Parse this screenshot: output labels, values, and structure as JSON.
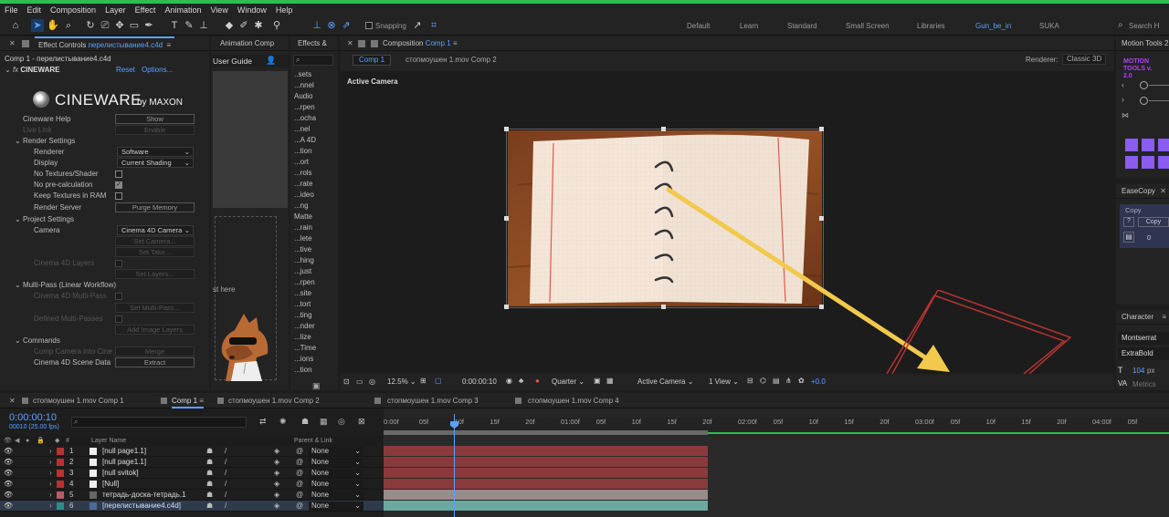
{
  "menu": [
    "File",
    "Edit",
    "Composition",
    "Layer",
    "Effect",
    "Animation",
    "View",
    "Window",
    "Help"
  ],
  "toolbar": {
    "snapping_label": "Snapping",
    "workspaces": [
      "Default",
      "Learn",
      "Standard",
      "Small Screen",
      "Libraries",
      "Gun_be_in",
      "SUKA"
    ],
    "search_placeholder": "Search H"
  },
  "effect_controls": {
    "tab_label": "Effect Controls",
    "tab_file": "перелистывание4.c4d",
    "layer_path": "Comp 1 - перелистывание4.c4d",
    "fx_name": "CINEWARE",
    "reset": "Reset",
    "options": "Options...",
    "logo_text": "CINEWARE",
    "logo_by": "by MAXON",
    "rows": {
      "help_label": "Cineware Help",
      "help_btn": "Show",
      "live_link": "Live Link",
      "live_btn": "Enable",
      "render_settings": "Render Settings",
      "renderer_label": "Renderer",
      "renderer_value": "Software",
      "display_label": "Display",
      "display_value": "Current Shading",
      "no_textures": "No Textures/Shader",
      "no_precalc": "No pre-calculation",
      "keep_textures": "Keep Textures in RAM",
      "render_server": "Render Server",
      "purge_btn": "Purge Memory",
      "project_settings": "Project Settings",
      "camera_label": "Camera",
      "camera_value": "Cinema 4D Camera",
      "set_camera": "Set Camera...",
      "set_take": "Set Take...",
      "c4d_layers": "Cinema 4D Layers",
      "set_layers": "Set Layers...",
      "multipass": "Multi-Pass (Linear Workflow)",
      "c4d_multipass": "Cinema 4D Multi-Pass",
      "set_multipass": "Set Multi-Pass...",
      "defined_multipasses": "Defined Multi-Passes",
      "add_image_layers": "Add Image Layers",
      "commands": "Commands",
      "comp_camera": "Comp Camera into Cine",
      "merge_btn": "Merge",
      "scene_data": "Cinema 4D Scene Data",
      "extract_btn": "Extract"
    }
  },
  "animation_composer": {
    "tab": "Animation Comp",
    "user_guide": "User Guide",
    "drop_text": "st here"
  },
  "effects_panel": {
    "tab": "Effects &",
    "items": [
      "..sets",
      "...nnel",
      "Audio",
      "...rpen",
      "...ocha",
      "...nel",
      "...A 4D",
      "...tion",
      "...ort",
      "...rols",
      "...rate",
      "...ideo",
      "...ng",
      "Matte",
      "...rain",
      "...lete",
      "...tive",
      "...hing",
      "...just",
      "...rpen",
      "...site",
      "...tort",
      "...ting",
      "...nder",
      "...lize",
      "...Time",
      "...ions",
      "...tion"
    ]
  },
  "composition": {
    "tab_label": "Composition",
    "tab_name": "Comp 1",
    "subtabs": [
      "Comp 1",
      "стопмоушен 1.mov Comp 2"
    ],
    "renderer_label": "Renderer:",
    "renderer_value": "Classic 3D",
    "active_camera_label": "Active Camera",
    "footer": {
      "zoom": "12.5%",
      "timecode": "0:00:00:10",
      "resolution": "Quarter",
      "camera": "Active Camera",
      "views": "1 View",
      "exposure": "+0.0"
    }
  },
  "right_panels": {
    "motion_tools_tab": "Motion Tools 2",
    "motion_tools_logo": "MOTION TOOLS v. 2.0",
    "easecopy_tab": "EaseCopy",
    "easecopy_label": "Copy",
    "easecopy_copy_btn": "Copy",
    "easecopy_value": "0",
    "character_tab": "Character",
    "font_family": "Montserrat",
    "font_style": "ExtraBold",
    "font_size": "104",
    "font_unit": "px",
    "metrics": "Metrics"
  },
  "timeline": {
    "tabs": [
      "стопмоушен 1.mov Comp 1",
      "Comp 1",
      "стопмоушен 1.mov Comp 2",
      "стопмоушен 1.mov Comp 3",
      "стопмоушен 1.mov Comp 4"
    ],
    "timecode": "0:00:00:10",
    "fps": "00010 (25.00 fps)",
    "search_placeholder": "",
    "col_layer_name": "Layer Name",
    "col_parent": "Parent & Link",
    "ruler": [
      "0:00f",
      "05f",
      "10f",
      "15f",
      "20f",
      "01:00f",
      "05f",
      "10f",
      "15f",
      "20f",
      "02:00f",
      "05f",
      "10f",
      "15f",
      "20f",
      "03:00f",
      "05f",
      "10f",
      "15f",
      "20f",
      "04:00f",
      "05f"
    ],
    "layers": [
      {
        "num": "1",
        "name": "[null page1.1]",
        "parent": "None"
      },
      {
        "num": "2",
        "name": "[null page1.1]",
        "parent": "None"
      },
      {
        "num": "3",
        "name": "[null svitok]",
        "parent": "None"
      },
      {
        "num": "4",
        "name": "[Null]",
        "parent": "None"
      },
      {
        "num": "5",
        "name": "тетрадь-доска-тетрадь.1",
        "parent": "None"
      },
      {
        "num": "6",
        "name": "[перелистывание4.c4d]",
        "parent": "None"
      }
    ]
  }
}
